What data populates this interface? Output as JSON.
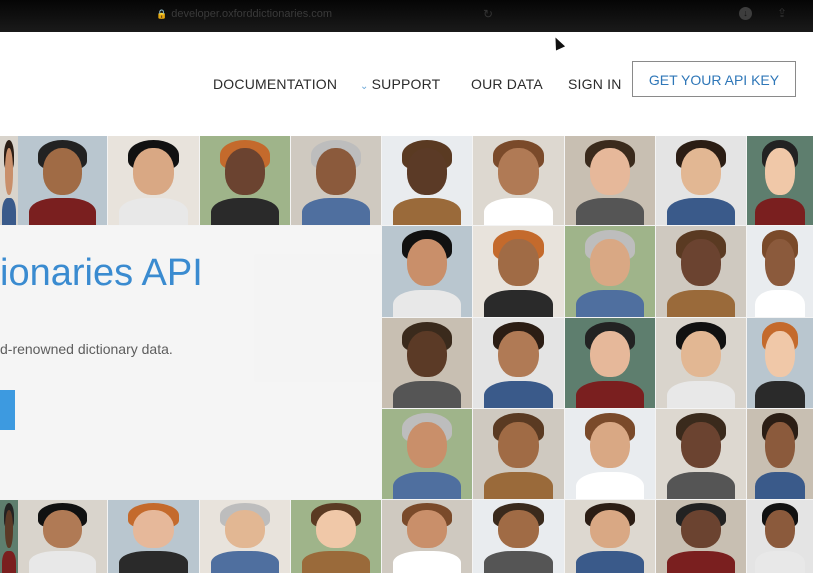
{
  "browser": {
    "url": "developer.oxforddictionaries.com",
    "lock_glyph": "🔒",
    "reload_glyph": "↻",
    "download_glyph": "↓",
    "share_glyph": "⇪"
  },
  "nav": {
    "documentation": "DOCUMENTATION",
    "support": "SUPPORT",
    "support_chevron": "⌄",
    "our_data": "OUR DATA",
    "sign_in": "SIGN IN",
    "api_key": "GET YOUR API KEY"
  },
  "hero": {
    "title": "ionaries API",
    "subtitle": "d-renowned dictionary data."
  },
  "colors": {
    "accent": "#2f77b8",
    "title": "#3a8bd0",
    "button": "#3d9ae0"
  }
}
